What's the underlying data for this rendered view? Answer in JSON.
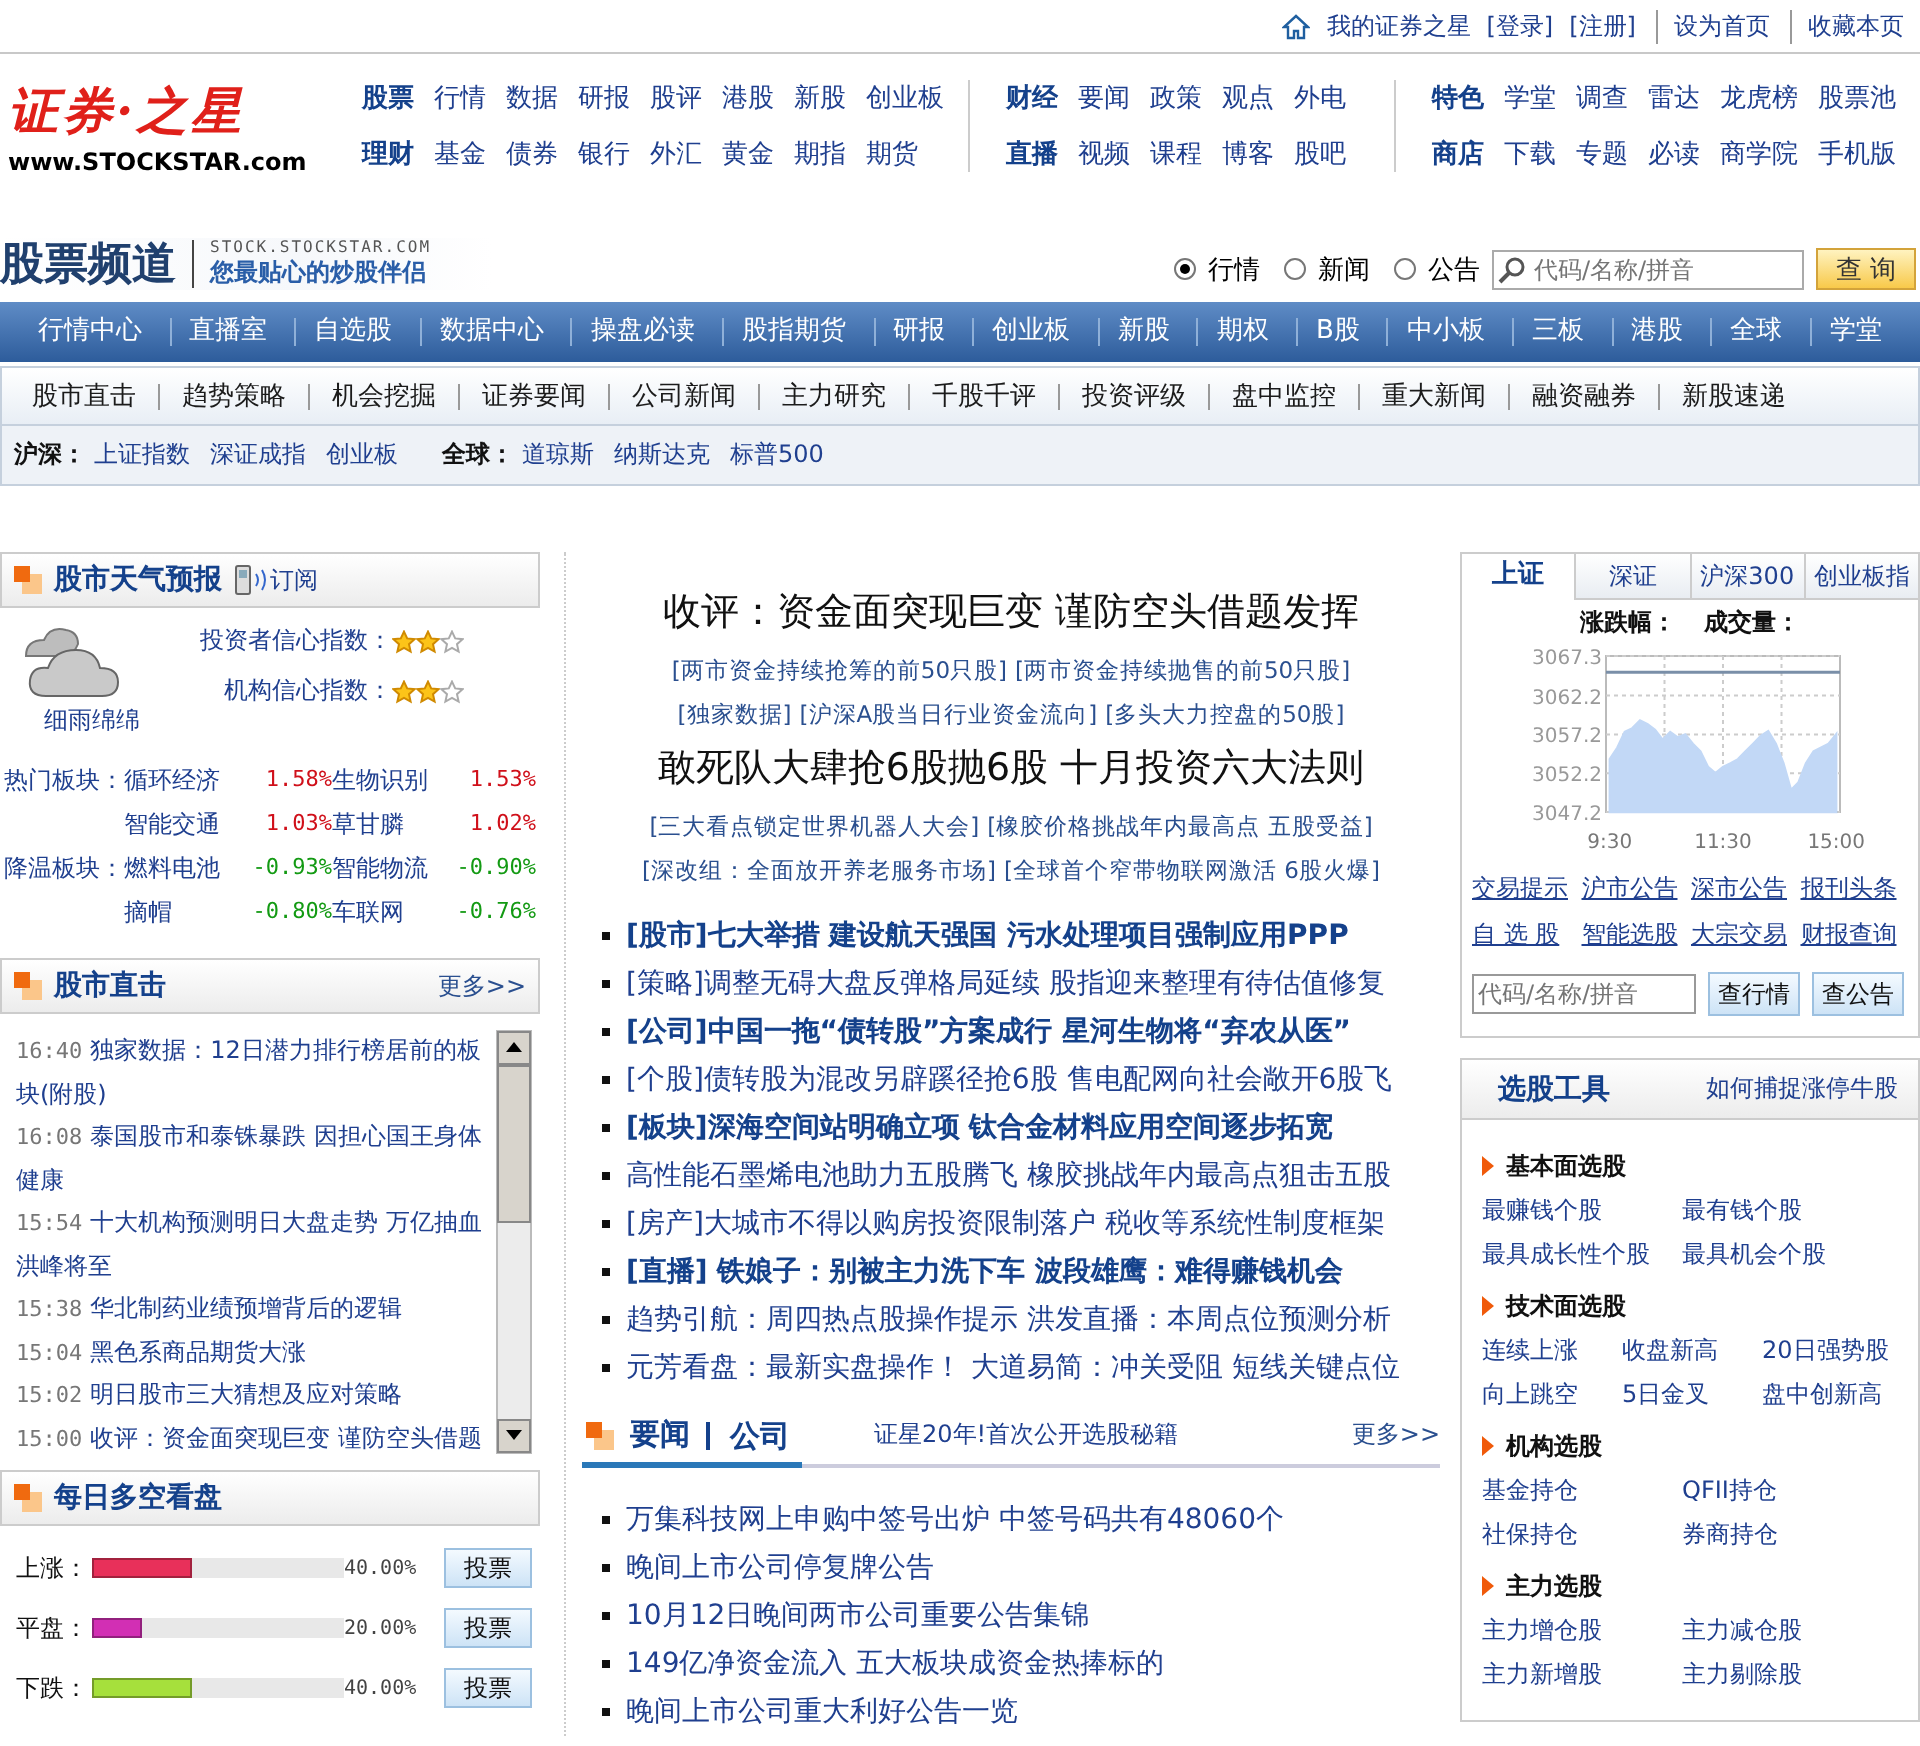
{
  "top_links": [
    {
      "text": "我的证券之星",
      "separated": false
    },
    {
      "text": "[登录]",
      "separated": false
    },
    {
      "text": "[注册]",
      "separated": false
    },
    {
      "text": "设为首页",
      "separated": true
    },
    {
      "text": "收藏本页",
      "separated": true
    }
  ],
  "logo": {
    "mark": "证券·之星",
    "url": "www.STOCKSTAR.com"
  },
  "header_nav": [
    {
      "rows": [
        {
          "head": "股票",
          "links": [
            "行情",
            "数据",
            "研报",
            "股评",
            "港股",
            "新股",
            "创业板"
          ]
        },
        {
          "head": "理财",
          "links": [
            "基金",
            "债券",
            "银行",
            "外汇",
            "黄金",
            "期指",
            "期货"
          ]
        }
      ]
    },
    {
      "rows": [
        {
          "head": "财经",
          "links": [
            "要闻",
            "政策",
            "观点",
            "外电"
          ]
        },
        {
          "head": "直播",
          "links": [
            "视频",
            "课程",
            "博客",
            "股吧"
          ]
        }
      ]
    },
    {
      "rows": [
        {
          "head": "特色",
          "links": [
            "学堂",
            "调查",
            "雷达",
            "龙虎榜",
            "股票池"
          ]
        },
        {
          "head": "商店",
          "links": [
            "下载",
            "专题",
            "必读",
            "商学院",
            "手机版"
          ]
        }
      ]
    }
  ],
  "channel": {
    "title": "股票频道",
    "domain": "STOCK.STOCKSTAR.COM",
    "slogan": "您最贴心的炒股伴侣"
  },
  "search": {
    "options": [
      {
        "label": "行情",
        "selected": true
      },
      {
        "label": "新闻",
        "selected": false
      },
      {
        "label": "公告",
        "selected": false
      }
    ],
    "placeholder": "代码/名称/拼音",
    "button": "查 询"
  },
  "main_nav": [
    "行情中心",
    "直播室",
    "自选股",
    "数据中心",
    "操盘必读",
    "股指期货",
    "研报",
    "创业板",
    "新股",
    "期权",
    "B股",
    "中小板",
    "三板",
    "港股",
    "全球",
    "学堂"
  ],
  "sub_nav": [
    "股市直击",
    "趋势策略",
    "机会挖掘",
    "证券要闻",
    "公司新闻",
    "主力研究",
    "千股千评",
    "投资评级",
    "盘中监控",
    "重大新闻",
    "融资融券",
    "新股速递"
  ],
  "index_bar": [
    {
      "label": "沪深：",
      "links": [
        "上证指数",
        "深证成指",
        "创业板"
      ]
    },
    {
      "label": "全球：",
      "links": [
        "道琼斯",
        "纳斯达克",
        "标普500"
      ]
    }
  ],
  "weather": {
    "title": "股市天气预报",
    "subscribe": "订阅",
    "condition": "细雨绵绵",
    "ratings": [
      {
        "label": "投资者信心指数：",
        "stars": 2
      },
      {
        "label": "机构信心指数：",
        "stars": 2
      }
    ],
    "sectors": [
      {
        "label": "热门板块：",
        "rows": [
          [
            {
              "name": "循环经济",
              "change": "1.58%",
              "color": "#d0101a"
            },
            {
              "name": "生物识别",
              "change": "1.53%",
              "color": "#d0101a"
            }
          ],
          [
            {
              "name": "智能交通",
              "change": "1.03%",
              "color": "#d0101a"
            },
            {
              "name": "草甘膦",
              "change": "1.02%",
              "color": "#d0101a"
            }
          ]
        ]
      },
      {
        "label": "降温板块：",
        "rows": [
          [
            {
              "name": "燃料电池",
              "change": "-0.93%",
              "color": "#139a13"
            },
            {
              "name": "智能物流",
              "change": "-0.90%",
              "color": "#139a13"
            }
          ],
          [
            {
              "name": "摘帽",
              "change": "-0.80%",
              "color": "#139a13"
            },
            {
              "name": "车联网",
              "change": "-0.76%",
              "color": "#139a13"
            }
          ]
        ]
      }
    ]
  },
  "live": {
    "title": "股市直击",
    "more": "更多>>",
    "items": [
      {
        "time": "16:40",
        "text": "独家数据：12日潜力排行榜居前的板块(附股)"
      },
      {
        "time": "16:08",
        "text": "泰国股市和泰铢暴跌 因担心国王身体健康"
      },
      {
        "time": "15:54",
        "text": "十大机构预测明日大盘走势 万亿抽血洪峰将至"
      },
      {
        "time": "15:38",
        "text": "华北制药业绩预增背后的逻辑"
      },
      {
        "time": "15:04",
        "text": "黑色系商品期货大涨"
      },
      {
        "time": "15:02",
        "text": "明日股市三大猜想及应对策略"
      },
      {
        "time": "15:00",
        "text": "收评：资金面突现巨变 谨防空头借题"
      }
    ]
  },
  "poll": {
    "title": "每日多空看盘",
    "rows": [
      {
        "label": "上涨：",
        "level": 0.4,
        "reading": "40.00%",
        "button": "投票",
        "color": "#e8305a"
      },
      {
        "label": "平盘：",
        "level": 0.2,
        "reading": "20.00%",
        "button": "投票",
        "color": "#d22fb4"
      },
      {
        "label": "下跌：",
        "level": 0.4,
        "reading": "40.00%",
        "button": "投票",
        "color": "#a6e03c"
      }
    ]
  },
  "headlines": [
    {
      "title": "收评：资金面突现巨变 谨防空头借题发挥",
      "link_rows": [
        [
          "[两市资金持续抢筹的前50只股]",
          "[两市资金持续抛售的前50只股]"
        ],
        [
          "[独家数据]",
          "[沪深A股当日行业资金流向]",
          "[多头大力控盘的50股]"
        ]
      ]
    },
    {
      "title": "敢死队大肆抢6股抛6股 十月投资六大法则",
      "link_rows": [
        [
          "[三大看点锁定世界机器人大会]",
          "[橡胶价格挑战年内最高点 五股受益]"
        ],
        [
          "[深改组：全面放开养老服务市场]",
          "[全球首个窄带物联网激活 6股火爆]"
        ]
      ]
    }
  ],
  "news": [
    {
      "text": "[股市]七大举措 建设航天强国 污水处理项目强制应用PPP",
      "bold": true
    },
    {
      "text": "[策略]调整无碍大盘反弹格局延续 股指迎来整理有待估值修复",
      "bold": false
    },
    {
      "text": "[公司]中国一拖“债转股”方案成行 星河生物将“弃农从医”",
      "bold": true
    },
    {
      "text": "[个股]债转股为混改另辟蹊径抢6股 售电配网向社会敞开6股飞",
      "bold": false
    },
    {
      "text": "[板块]深海空间站明确立项 钛合金材料应用空间逐步拓宽",
      "bold": true
    },
    {
      "text": "高性能石墨烯电池助力五股腾飞 橡胶挑战年内最高点狙击五股",
      "bold": false
    },
    {
      "text": "[房产]大城市不得以购房投资限制落户 税收等系统性制度框架",
      "bold": false
    },
    {
      "text": "[直播] 铁娘子：别被主力洗下车 波段雄鹰：难得赚钱机会",
      "bold": true
    },
    {
      "text": "趋势引航：周四热点股操作提示 洪发直播：本周点位预测分析",
      "bold": false
    },
    {
      "text": "元芳看盘：最新实盘操作！ 大道易简：冲关受阻 短线关键点位",
      "bold": false
    }
  ],
  "company_news": {
    "tabs": [
      "要闻",
      "公司"
    ],
    "promo": "证星20年!首次公开选股秘籍",
    "more": "更多>>",
    "items": [
      "万集科技网上申购中签号出炉 中签号码共有48060个",
      "晚间上市公司停复牌公告",
      "10月12日晚间两市公司重要公告集锦",
      "149亿净资金流入 五大板块成资金热捧标的",
      "晚间上市公司重大利好公告一览"
    ]
  },
  "market": {
    "tabs": [
      {
        "label": "上证",
        "selected": true
      },
      {
        "label": "深证",
        "selected": false
      },
      {
        "label": "沪深300",
        "selected": false
      },
      {
        "label": "创业板指",
        "selected": false
      }
    ],
    "labels": [
      "涨跌幅：",
      "成交量："
    ],
    "chart_data": {
      "type": "area",
      "categories": [
        "9:30",
        null,
        null,
        null,
        null,
        null,
        null,
        null,
        null,
        null,
        null,
        null,
        null,
        null,
        null,
        "11:30",
        null,
        null,
        null,
        null,
        null,
        null,
        null,
        null,
        null,
        null,
        null,
        null,
        null,
        null,
        "15:00"
      ],
      "series": [
        {
          "color": "#c2d8f6",
          "values": [
            3054,
            3055.5,
            3057.5,
            3058,
            3059,
            3058.5,
            3057.8,
            3056.5,
            3057.5,
            3056.8,
            3057.2,
            3056,
            3055,
            3053,
            3052.2,
            3053,
            3053.5,
            3054,
            3055,
            3056,
            3057,
            3057.6,
            3056,
            3053.5,
            3050,
            3051,
            3053.5,
            3055,
            3055.5,
            3056,
            3057.2
          ]
        }
      ],
      "ylim": [
        3047.2,
        3067.3
      ],
      "yticks": [
        3047.2,
        3052.2,
        3057.2,
        3062.2,
        3067.3
      ],
      "grid": true,
      "ref_lines": [
        {
          "axis": "y",
          "value": 3065.2
        }
      ]
    },
    "links": [
      "交易提示",
      "沪市公告",
      "深市公告",
      "报刊头条",
      "自 选 股",
      "智能选股",
      "大宗交易",
      "财报查询"
    ],
    "placeholder": "代码/名称/拼音",
    "buttons": [
      "查行情",
      "查公告"
    ]
  },
  "stock_tools": {
    "title": "选股工具",
    "link": "如何捕捉涨停牛股",
    "groups": [
      {
        "title": "基本面选股",
        "items": [
          "最赚钱个股",
          "最有钱个股",
          "最具成长性个股",
          "最具机会个股"
        ]
      },
      {
        "title": "技术面选股",
        "items": [
          "连续上涨",
          "收盘新高",
          "20日强势股",
          "向上跳空",
          "5日金叉",
          "盘中创新高"
        ]
      },
      {
        "title": "机构选股",
        "items": [
          "基金持仓",
          "QFII持仓",
          "社保持仓",
          "券商持仓"
        ]
      },
      {
        "title": "主力选股",
        "items": [
          "主力增仓股",
          "主力减仓股",
          "主力新增股",
          "主力剔除股"
        ]
      }
    ]
  }
}
